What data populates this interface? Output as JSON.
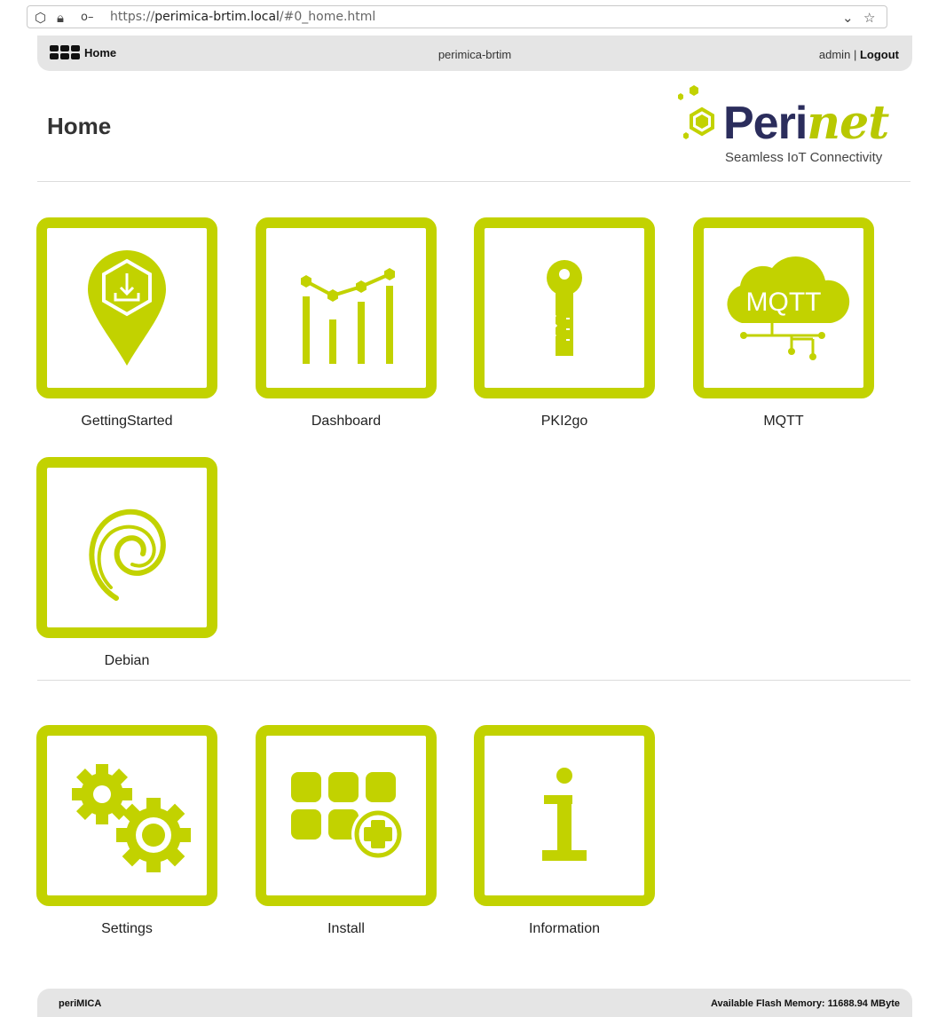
{
  "browser": {
    "url_prefix": "https://",
    "url_host": "perimica-brtim.local",
    "url_path": "/#0_home.html"
  },
  "topbar": {
    "home_label": "Home",
    "device_name": "perimica-brtim",
    "user": "admin",
    "separator": "|",
    "logout_label": "Logout"
  },
  "page": {
    "title": "Home"
  },
  "logo": {
    "brand_a": "Peri",
    "brand_b": "net",
    "tagline": "Seamless IoT Connectivity",
    "accent_color": "#c2d200",
    "brand_color": "#2b2d5c"
  },
  "apps": [
    {
      "label": "GettingStarted",
      "icon": "map-pin-download-icon"
    },
    {
      "label": "Dashboard",
      "icon": "chart-icon"
    },
    {
      "label": "PKI2go",
      "icon": "key-icon"
    },
    {
      "label": "MQTT",
      "icon": "cloud-mqtt-icon"
    },
    {
      "label": "Debian",
      "icon": "debian-swirl-icon"
    }
  ],
  "system": [
    {
      "label": "Settings",
      "icon": "gears-icon"
    },
    {
      "label": "Install",
      "icon": "apps-add-icon"
    },
    {
      "label": "Information",
      "icon": "info-icon"
    }
  ],
  "footer": {
    "product": "periMICA",
    "flash_memory": "Available Flash Memory: 11688.94 MByte"
  }
}
